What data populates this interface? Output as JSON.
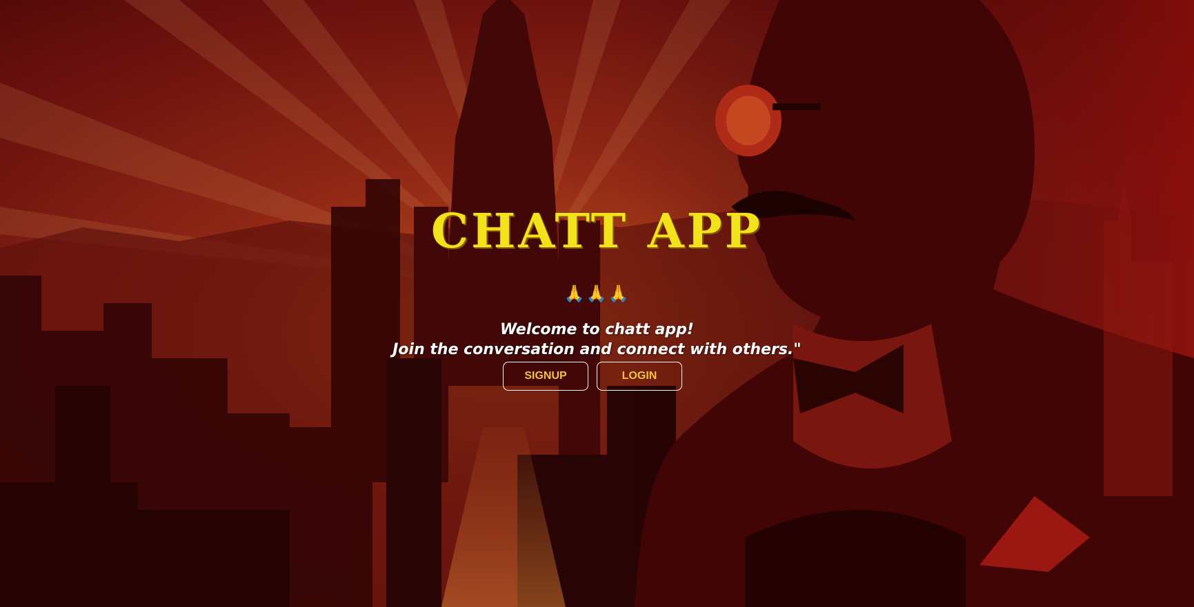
{
  "hero": {
    "title": "CHATT APP",
    "emoji": "🙏🙏🙏",
    "welcome_line1": "Welcome to chatt app!",
    "welcome_line2": "Join the conversation and connect with others.\""
  },
  "actions": {
    "signup_label": "SIGNUP",
    "login_label": "LOGIN"
  },
  "colors": {
    "title": "#f2e21b",
    "button_text": "#f5c23a",
    "button_border": "#ffffff",
    "background_primary": "#8a1410"
  },
  "background": {
    "icon": "city-skyline-illustration",
    "figure": "man-with-sunglasses-illustration"
  }
}
